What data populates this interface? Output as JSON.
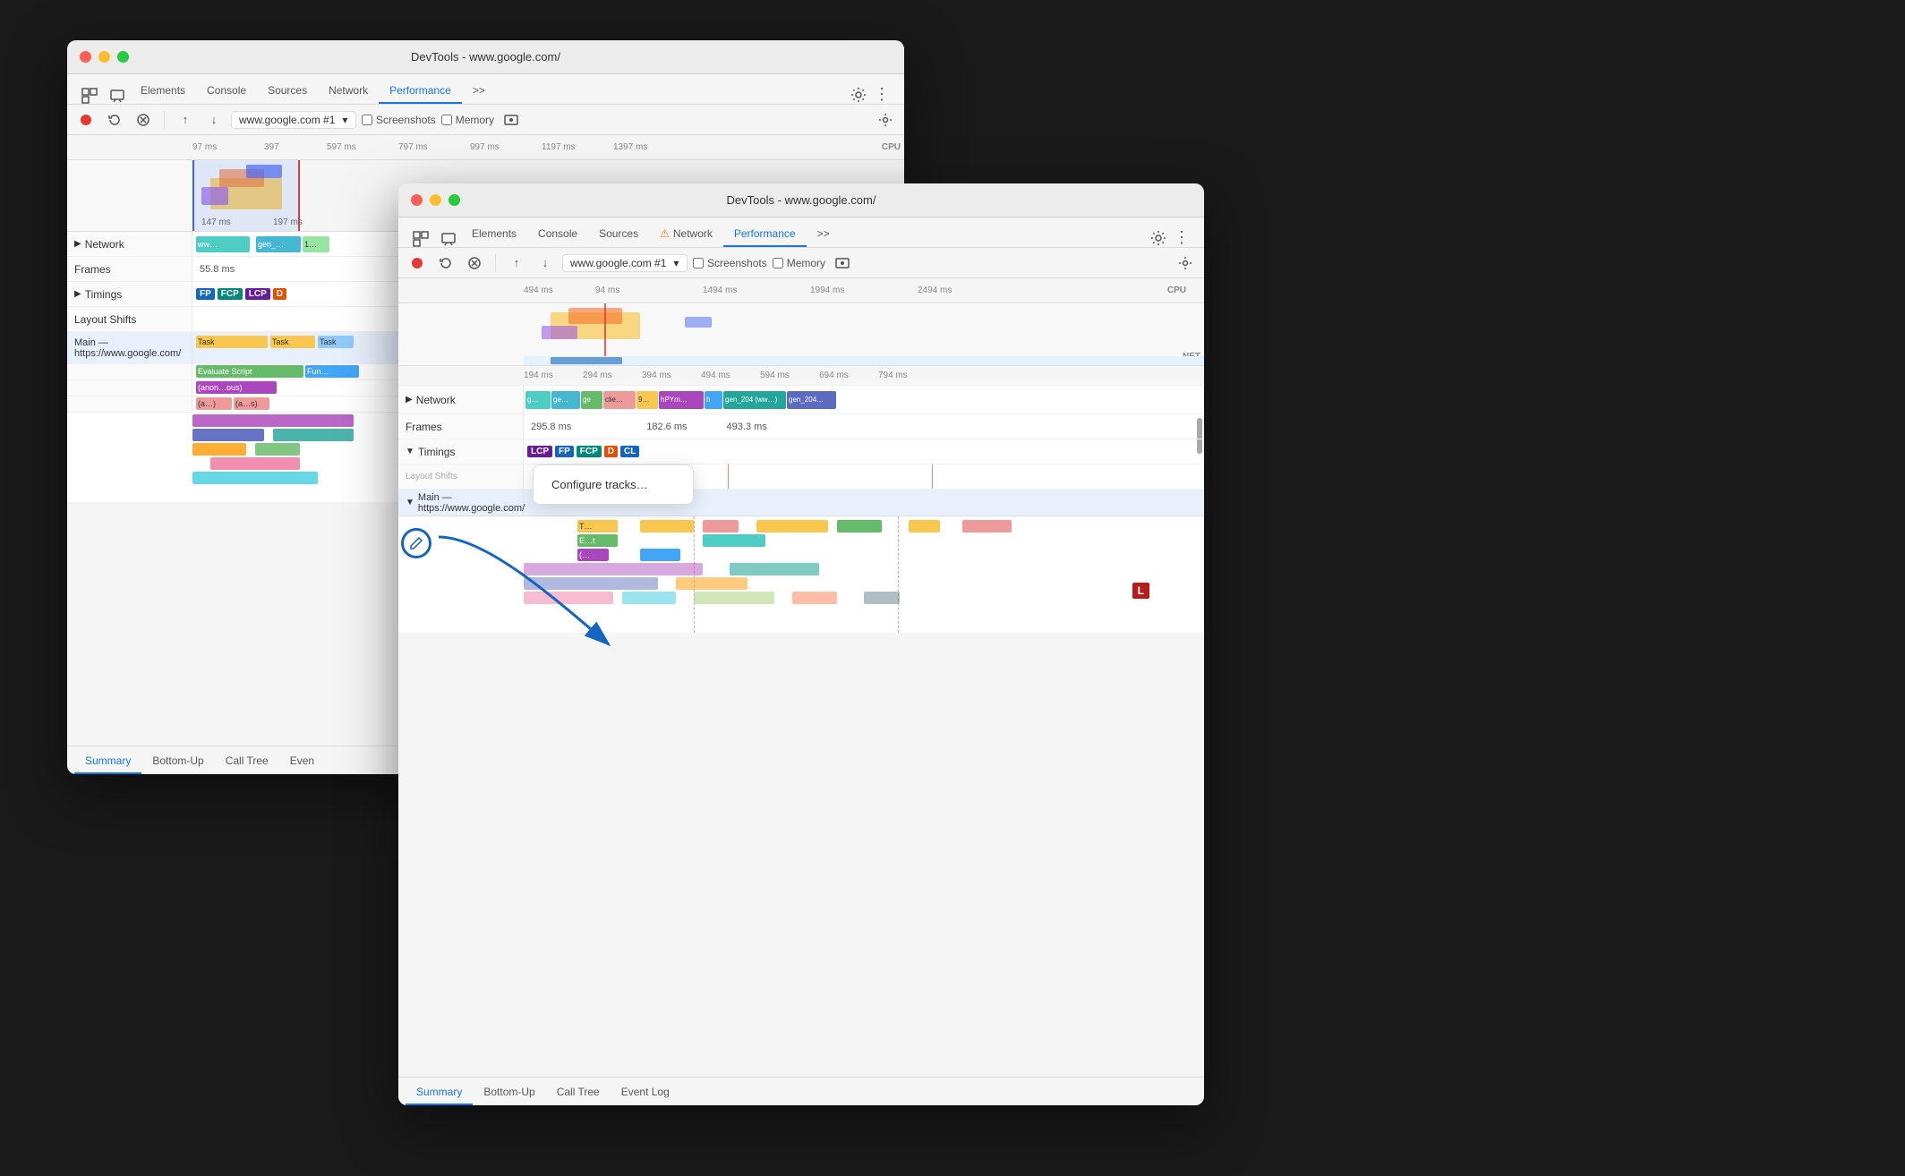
{
  "window1": {
    "title": "DevTools - www.google.com/",
    "tabs": [
      "Elements",
      "Console",
      "Sources",
      "Network",
      "Performance"
    ],
    "activeTab": "Performance",
    "moreTabsIcon": ">>",
    "perfToolbar": {
      "urlLabel": "www.google.com #1",
      "screenshots": "Screenshots",
      "memory": "Memory"
    },
    "rulerLabels": [
      "97 ms",
      "397 ms",
      "597 ms",
      "797 ms",
      "997 ms",
      "1197 ms",
      "1397 ms"
    ],
    "timelineLabels": [
      "147 ms",
      "197 ms"
    ],
    "cpuLabel": "CPU",
    "tracks": {
      "network": "Network",
      "frames": "Frames",
      "frameValue": "55.8 ms",
      "timings": "Timings",
      "timingBadges": [
        "FP",
        "FCP",
        "LCP",
        "D"
      ],
      "layoutShifts": "Layout Shifts",
      "main": "Main — https://www.google.com/",
      "tasks": [
        "Task",
        "Task"
      ],
      "evaluateScript": "Evaluate Script",
      "functionLabel": "Fun...",
      "anonymous": "(anon…ous)",
      "aRefs": [
        "(a…)",
        "(a…s)"
      ]
    },
    "bottomTabs": [
      "Summary",
      "Bottom-Up",
      "Call Tree",
      "Even"
    ],
    "activeBottomTab": "Summary"
  },
  "window2": {
    "title": "DevTools - www.google.com/",
    "tabs": [
      "Elements",
      "Console",
      "Sources",
      "Network",
      "Performance"
    ],
    "activeTab": "Performance",
    "networkWarning": true,
    "moreTabsIcon": ">>",
    "perfToolbar": {
      "urlLabel": "www.google.com #1",
      "screenshots": "Screenshots",
      "memory": "Memory"
    },
    "rulerLabels": [
      "494 ms",
      "94 ms",
      "1494 ms",
      "1994 ms",
      "2494 ms"
    ],
    "cpuLabel": "CPU",
    "netLabel": "NET",
    "timelineLabels": [
      "194 ms",
      "294 ms",
      "394 ms",
      "494 ms",
      "594 ms",
      "694 ms",
      "794 ms"
    ],
    "tracks": {
      "network": "Network",
      "networkBlocks": [
        "g…",
        "ge…",
        "ge",
        "clie…",
        "9…",
        "hPYm…",
        "h",
        "gen_204 (ww…)",
        "gen_204…"
      ],
      "frames": "Frames",
      "framesValues": [
        "295.8 ms",
        "182.6 ms",
        "493.3 ms"
      ],
      "timings": "Timings",
      "timingBadges": [
        "LCP",
        "FP",
        "FCP",
        "D",
        "CL"
      ],
      "timingLBadge": "L",
      "layoutShifts": "Layout Shifts",
      "main": "Main — https://www.google.com/",
      "mainBlocks": [
        "T…",
        "E…t",
        "(…"
      ]
    },
    "popup": {
      "label": "Configure tracks…"
    },
    "bottomTabs": [
      "Summary",
      "Bottom-Up",
      "Call Tree",
      "Event Log"
    ],
    "activeBottomTab": "Summary"
  },
  "annotation": {
    "editIconLabel": "edit",
    "arrowLabel": "configure tracks arrow"
  }
}
